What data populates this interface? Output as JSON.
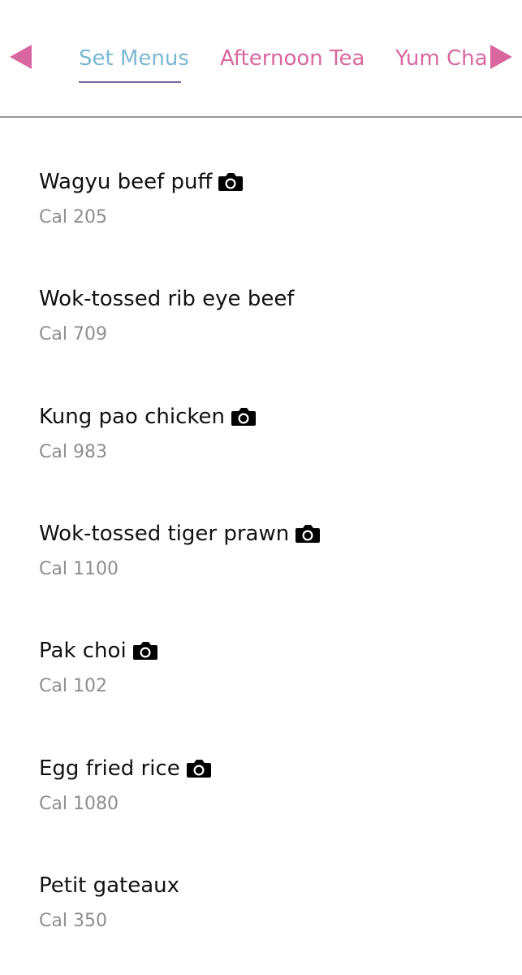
{
  "tabs": {
    "prev_icon": "triangle-left-icon",
    "next_icon": "triangle-right-icon",
    "items": [
      {
        "label": "Set Menus",
        "active": true
      },
      {
        "label": "Afternoon Tea",
        "active": false
      },
      {
        "label": "Yum Cha",
        "active": false
      }
    ]
  },
  "colors": {
    "tab_inactive": "#d9679f",
    "tab_active": "#7cb8d3",
    "underline": "#7e64a5",
    "item_text": "#111111",
    "calorie_text": "#8e8e8e",
    "divider": "#9a9a9a"
  },
  "menu": {
    "items": [
      {
        "name": "Wagyu beef puff",
        "calories": "Cal 205",
        "has_photo": true
      },
      {
        "name": "Wok-tossed rib eye beef",
        "calories": "Cal 709",
        "has_photo": false
      },
      {
        "name": "Kung pao chicken",
        "calories": "Cal 983",
        "has_photo": true
      },
      {
        "name": "Wok-tossed tiger prawn",
        "calories": "Cal 1100",
        "has_photo": true
      },
      {
        "name": "Pak choi",
        "calories": "Cal 102",
        "has_photo": true
      },
      {
        "name": "Egg fried rice",
        "calories": "Cal 1080",
        "has_photo": true
      },
      {
        "name": "Petit gateaux",
        "calories": "Cal 350",
        "has_photo": false
      }
    ],
    "photo_icon": "camera-icon"
  }
}
